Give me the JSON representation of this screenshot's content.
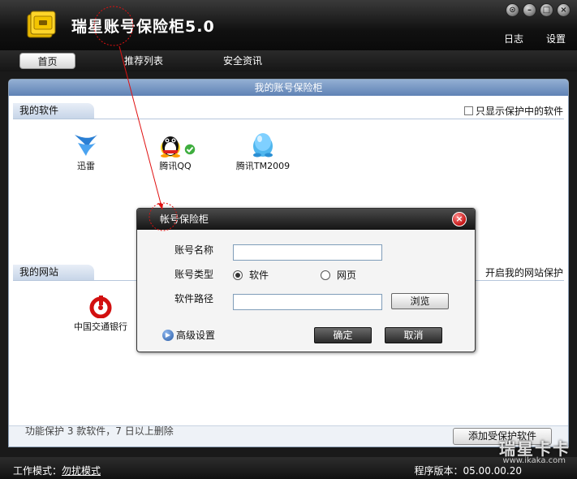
{
  "app": {
    "title": "瑞星账号保险柜5.0"
  },
  "top_links": {
    "log": "日志",
    "settings": "设置"
  },
  "window_buttons": {
    "restore": "⊙",
    "minimize": "–",
    "maximize": "□",
    "close": "×"
  },
  "tabs": [
    {
      "label": "首页",
      "active": true
    },
    {
      "label": "推荐列表",
      "active": false
    },
    {
      "label": "安全资讯",
      "active": false
    }
  ],
  "main": {
    "header": "我的账号保险柜",
    "software_section": {
      "title": "我的软件",
      "checkbox_label": "只显示保护中的软件",
      "items": [
        {
          "name": "迅雷",
          "icon": "xunlei-icon"
        },
        {
          "name": "腾讯QQ",
          "icon": "qq-icon",
          "protected": true
        },
        {
          "name": "腾讯TM2009",
          "icon": "tm-icon"
        }
      ]
    },
    "website_section": {
      "title": "我的网站",
      "checkbox_label": "开启我的网站保护",
      "items": [
        {
          "name": "中国交通银行",
          "icon": "bocom-icon"
        }
      ]
    },
    "status_hint": "功能保护 3 款软件，7 日以上删除",
    "add_button": "添加受保护软件"
  },
  "dialog": {
    "title": "帐号保险柜",
    "account_name_label": "账号名称",
    "account_name_value": "",
    "account_type_label": "账号类型",
    "type_options": [
      {
        "label": "软件",
        "selected": true
      },
      {
        "label": "网页",
        "selected": false
      }
    ],
    "path_label": "软件路径",
    "path_value": "",
    "browse_button": "浏览",
    "advanced_label": "高级设置",
    "ok_button": "确定",
    "cancel_button": "取消",
    "close_symbol": "×"
  },
  "bottom": {
    "mode_label": "工作模式：",
    "mode_value": "勿扰模式",
    "version_label": "程序版本：",
    "version_value": "05.00.00.20"
  },
  "watermark": {
    "brand": "瑞星卡卡",
    "url": "www.ikaka.com"
  },
  "colors": {
    "panel_header": "#5f82b5",
    "annotation": "#e01010",
    "ok_check": "#3fae3f"
  }
}
